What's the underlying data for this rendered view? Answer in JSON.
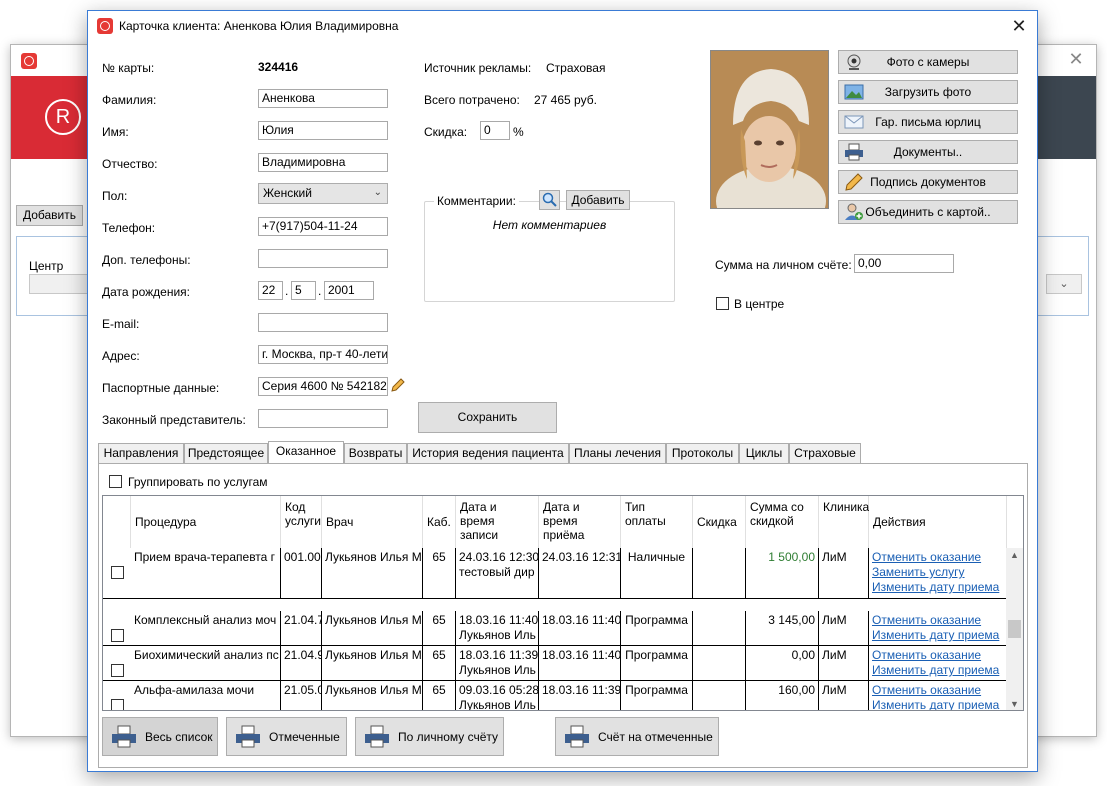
{
  "background_window": {
    "add_button": "Добавить",
    "filter_label": "Центр"
  },
  "dialog": {
    "title": "Карточка клиента:  Аненкова Юлия Владимировна",
    "fields": {
      "card_no_label": "№ карты:",
      "card_no": "324416",
      "last_name_label": "Фамилия:",
      "last_name": "Аненкова",
      "first_name_label": "Имя:",
      "first_name": "Юлия",
      "patronymic_label": "Отчество:",
      "patronymic": "Владимировна",
      "sex_label": "Пол:",
      "sex": "Женский",
      "phone_label": "Телефон:",
      "phone": "+7(917)504-11-24",
      "extra_phones_label": "Доп. телефоны:",
      "extra_phones": "",
      "birth_label": "Дата рождения:",
      "birth_day": "22",
      "birth_month": "5",
      "birth_year": "2001",
      "email_label": "E-mail:",
      "email": "",
      "address_label": "Адрес:",
      "address": "г. Москва, пр-т 40-лети",
      "passport_label": "Паспортные данные:",
      "passport": "Серия 4600 № 542182",
      "representative_label": "Законный представитель:",
      "representative": ""
    },
    "info": {
      "ad_source_label": "Источник рекламы:",
      "ad_source": "Страховая",
      "spent_label": "Всего потрачено:",
      "spent": "27 465 руб.",
      "discount_label": "Скидка:",
      "discount": "0",
      "discount_unit": "%"
    },
    "comments": {
      "label": "Комментарии:",
      "add_button": "Добавить",
      "empty_text": "Нет комментариев"
    },
    "save_button": "Сохранить",
    "side_buttons": [
      {
        "label": "Фото с камеры",
        "icon": "webcam-icon"
      },
      {
        "label": "Загрузить фото",
        "icon": "picture-icon"
      },
      {
        "label": "Гар. письма юрлиц",
        "icon": "envelope-icon"
      },
      {
        "label": "Документы..",
        "icon": "printer-icon"
      },
      {
        "label": "Подпись документов",
        "icon": "pencil-icon"
      },
      {
        "label": "Объединить с картой..",
        "icon": "users-add-icon"
      }
    ],
    "balance_label": "Сумма на личном счёте:",
    "balance": "0,00",
    "in_center_label": "В центре",
    "tabs": [
      "Направления",
      "Предстоящее",
      "Оказанное",
      "Возвраты",
      "История ведения пациента",
      "Планы лечения",
      "Протоколы",
      "Циклы",
      "Страховые"
    ],
    "active_tab": "Оказанное",
    "group_by_services_label": "Группировать по услугам",
    "table": {
      "headers": {
        "procedure": "Процедура",
        "code": "Код услуги",
        "doctor": "Врач",
        "cabinet": "Каб.",
        "record_date": "Дата и время записи",
        "visit_date": "Дата и время приёма",
        "pay_type": "Тип оплаты",
        "discount": "Скидка",
        "sum": "Сумма со скидкой",
        "clinic": "Клиника",
        "actions": "Действия"
      },
      "rows": [
        {
          "procedure": "Прием врача-терапевта  г",
          "code": "001.00",
          "doctor": "Лукьянов Илья М",
          "cabinet": "65",
          "record1": "24.03.16 12:30",
          "record2": "тестовый дир",
          "visit": "24.03.16 12:31",
          "pay": "Наличные",
          "discount": "",
          "sum": "1 500,00",
          "clinic": "ЛиМ",
          "actions": [
            "Отменить оказание",
            "Заменить услугу",
            "Изменить дату приема"
          ]
        },
        {
          "procedure": "Комплексный анализ моч",
          "code": "21.04.7",
          "doctor": "Лукьянов Илья М",
          "cabinet": "65",
          "record1": "18.03.16 11:40",
          "record2": "Лукьянов Иль",
          "visit": "18.03.16 11:40",
          "pay": "Программа",
          "discount": "",
          "sum": "3 145,00",
          "clinic": "ЛиМ",
          "actions": [
            "Отменить оказание",
            "Изменить дату приема"
          ]
        },
        {
          "procedure": "Биохимический анализ пс",
          "code": "21.04.9",
          "doctor": "Лукьянов Илья М",
          "cabinet": "65",
          "record1": "18.03.16 11:39",
          "record2": "Лукьянов Иль",
          "visit": "18.03.16 11:40",
          "pay": "Программа",
          "discount": "",
          "sum": "0,00",
          "clinic": "ЛиМ",
          "actions": [
            "Отменить оказание",
            "Изменить дату приема"
          ]
        },
        {
          "procedure": "Альфа-амилаза мочи",
          "code": "21.05.0",
          "doctor": "Лукьянов Илья М",
          "cabinet": "65",
          "record1": "09.03.16 05:28",
          "record2": "Лукьянов Иль",
          "visit": "18.03.16 11:39",
          "pay": "Программа",
          "discount": "",
          "sum": "160,00",
          "clinic": "ЛиМ",
          "actions": [
            "Отменить оказание",
            "Изменить дату приема"
          ]
        }
      ]
    },
    "bottom_buttons": [
      "Весь список",
      "Отмеченные",
      "По личному счёту",
      "Счёт на отмеченные"
    ],
    "colors": {
      "accent_red": "#d92b35",
      "header_dark": "#3c4650",
      "link": "#1a5fb4",
      "sum_green": "#2e7d32"
    }
  }
}
